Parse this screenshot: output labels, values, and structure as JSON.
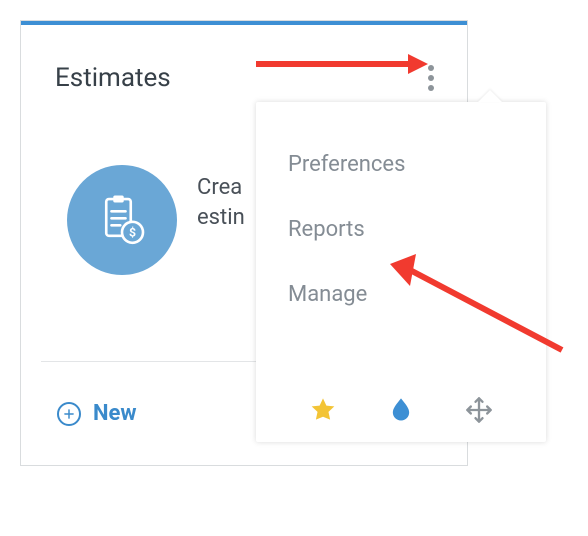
{
  "card": {
    "title": "Estimates",
    "desc_line1": "Crea",
    "desc_line2": "estin",
    "new_label": "New"
  },
  "dropdown": {
    "items": [
      {
        "label": "Preferences"
      },
      {
        "label": "Reports"
      },
      {
        "label": "Manage"
      }
    ]
  }
}
